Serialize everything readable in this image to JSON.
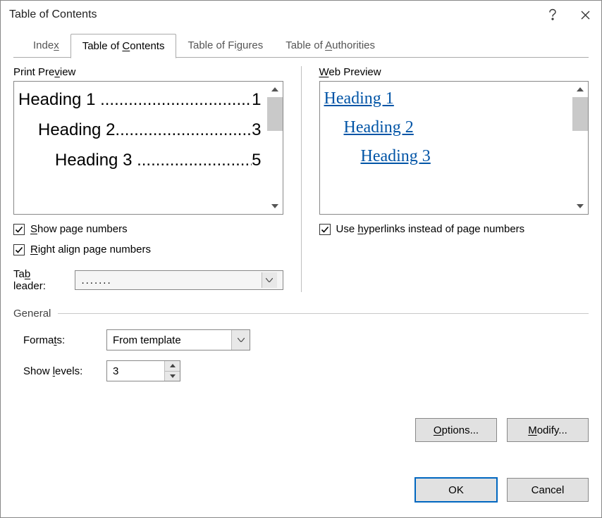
{
  "title": "Table of Contents",
  "tabs": {
    "index": "Index",
    "toc": "Table of Contents",
    "figures": "Table of Figures",
    "authorities": "Table of Authorities"
  },
  "print_preview": {
    "label": "Print Preview",
    "rows": [
      {
        "text": "Heading 1",
        "page": "1"
      },
      {
        "text": "Heading 2",
        "page": "3"
      },
      {
        "text": "Heading 3",
        "page": "5"
      }
    ]
  },
  "web_preview": {
    "label": "Web Preview",
    "rows": [
      "Heading 1",
      "Heading 2",
      "Heading 3"
    ]
  },
  "checks": {
    "show_page_numbers_pre": "S",
    "show_page_numbers": "how page numbers",
    "right_align_pre": "R",
    "right_align": "ight align page numbers",
    "hyperlinks_pre": "Use ",
    "hyperlinks_u": "h",
    "hyperlinks_post": "yperlinks instead of page numbers"
  },
  "tab_leader": {
    "label_pre": "Ta",
    "label_u": "b",
    "label_post": " leader:",
    "value": "......."
  },
  "general": {
    "label": "General",
    "formats_label_pre": "Forma",
    "formats_label_u": "t",
    "formats_label_post": "s:",
    "formats_value": "From template",
    "levels_label_pre": "Show ",
    "levels_label_u": "l",
    "levels_label_post": "evels:",
    "levels_value": "3"
  },
  "buttons": {
    "options_u": "O",
    "options_post": "ptions...",
    "modify_u": "M",
    "modify_post": "odify...",
    "ok": "OK",
    "cancel": "Cancel"
  }
}
